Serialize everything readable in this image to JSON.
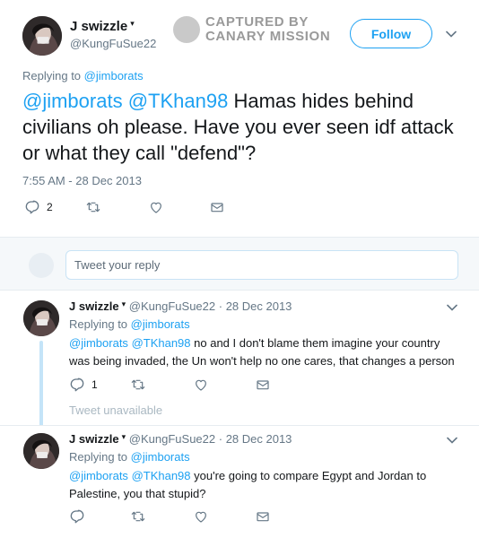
{
  "watermark": {
    "line1": "CAPTURED BY",
    "line2": "CANARY MISSION"
  },
  "main_tweet": {
    "name": "J swizzle",
    "handle": "@KungFuSue22",
    "follow_label": "Follow",
    "replying_prefix": "Replying to",
    "replying_to": "@jimborats",
    "mention1": "@jimborats",
    "mention2": "@TKhan98",
    "text": " Hamas hides behind civilians oh please.  Have you ever seen idf attack or what they call \"defend\"?",
    "timestamp": "7:55 AM - 28 Dec 2013",
    "reply_count": "2"
  },
  "reply_box": {
    "placeholder": "Tweet your reply"
  },
  "replies": [
    {
      "name": "J swizzle",
      "handle": "@KungFuSue22",
      "date": "· 28 Dec 2013",
      "replying_prefix": "Replying to",
      "replying_to": "@jimborats",
      "mention1": "@jimborats",
      "mention2": "@TKhan98",
      "text": " no and I don't blame them imagine your country was being invaded, the Un won't help no one cares, that changes a person",
      "reply_count": "1"
    },
    {
      "name": "J swizzle",
      "handle": "@KungFuSue22",
      "date": "· 28 Dec 2013",
      "replying_prefix": "Replying to",
      "replying_to": "@jimborats",
      "mention1": "@jimborats",
      "mention2": "@TKhan98",
      "text": " you're going to compare Egypt and Jordan to Palestine, you that stupid?",
      "reply_count": ""
    }
  ],
  "unavailable_text": "Tweet unavailable",
  "icons": {
    "reply": "reply-icon",
    "retweet": "retweet-icon",
    "like": "heart-icon",
    "dm": "envelope-icon",
    "more": "chevron-down-icon"
  },
  "colors": {
    "link": "#1da1f2",
    "muted": "#657786",
    "thread": "#c4e4f8"
  }
}
